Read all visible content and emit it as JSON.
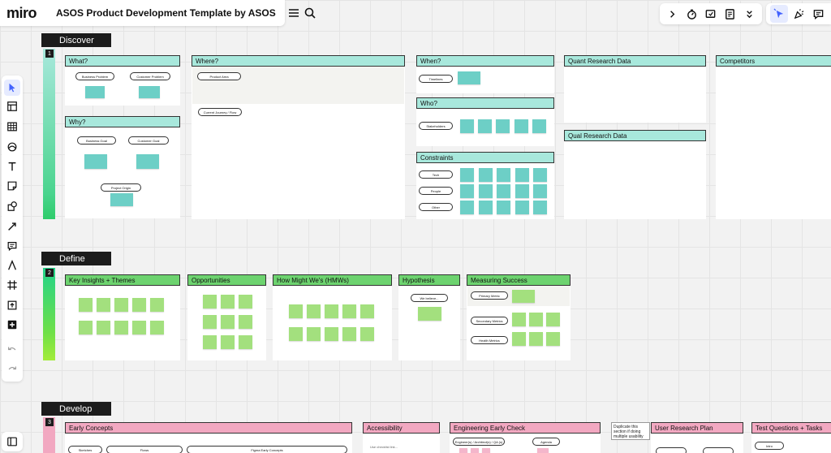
{
  "app": {
    "logo": "miro",
    "board_title": "ASOS Product Development Template by ASOS"
  },
  "colors": {
    "accent": "#4262ff",
    "discover_header": "#a8e8dc",
    "define_header": "#6dd36f",
    "develop_header": "#f2a8c1",
    "teal_sticky": "#6dcfc6",
    "green_sticky": "#a3e07e"
  },
  "top_left_icons": [
    "shield-badge-icon",
    "menu-icon",
    "search-icon"
  ],
  "top_right_icons": {
    "group1": [
      "chevron-right-icon",
      "timer-icon",
      "present-icon",
      "notes-icon",
      "chevron-double-down-icon"
    ],
    "group2": [
      "cursor-select-icon",
      "reactions-icon",
      "comments-icon"
    ]
  },
  "left_tools": [
    "select-icon",
    "templates-icon",
    "table-icon",
    "shapes-icon",
    "text-icon",
    "sticky-note-icon",
    "shape-icon",
    "connector-icon",
    "comment-icon",
    "pen-icon",
    "frame-icon",
    "upload-icon",
    "add-icon",
    "undo-icon",
    "redo-icon"
  ],
  "sections": {
    "discover": {
      "label": "Discover",
      "number": "1",
      "frames": {
        "what": {
          "title": "What?",
          "pills": [
            "Business Problem",
            "Customer Problem"
          ]
        },
        "why": {
          "title": "Why?",
          "pills": [
            "Business Goal",
            "Customer Goal",
            "Project Origin"
          ]
        },
        "where": {
          "title": "Where?",
          "pills": [
            "Product Area",
            "Current Journey / Flow"
          ]
        },
        "when": {
          "title": "When?",
          "pills": [
            "Timelines"
          ]
        },
        "who": {
          "title": "Who?",
          "pills": [
            "Stakeholders"
          ]
        },
        "constraints": {
          "title": "Constraints",
          "pills": [
            "Tech",
            "People",
            "Other"
          ]
        },
        "quant": {
          "title": "Quant Research Data"
        },
        "qual": {
          "title": "Qual Research Data"
        },
        "competitors": {
          "title": "Competitors"
        }
      }
    },
    "define": {
      "label": "Define",
      "number": "2",
      "frames": {
        "insights": {
          "title": "Key Insights + Themes"
        },
        "opportunities": {
          "title": "Opportunities"
        },
        "hmw": {
          "title": "How Might We's (HMWs)"
        },
        "hypothesis": {
          "title": "Hypothesis",
          "pills": [
            "We believe..."
          ]
        },
        "measuring": {
          "title": "Measuring Success",
          "pills": [
            "Primary Metric",
            "Secondary Metrics",
            "Health Metrics"
          ]
        }
      }
    },
    "develop": {
      "label": "Develop",
      "number": "3",
      "frames": {
        "early_concepts": {
          "title": "Early Concepts",
          "pills": [
            "Sketches",
            "Flows",
            "Figma Early Concepts"
          ]
        },
        "accessibility": {
          "title": "Accessibility",
          "note": "Use checklist link..."
        },
        "eng_check": {
          "title": "Engineering Early Check",
          "pills": [
            "Engineer(s) / Architect(s) / QA (s)",
            "Agenda"
          ]
        },
        "duplicate_note": "Duplicate this section if doing multiple usability tests—→",
        "research_plan": {
          "title": "User Research Plan"
        },
        "test_questions": {
          "title": "Test Questions + Tasks",
          "pills": [
            "Intro"
          ]
        }
      }
    }
  }
}
